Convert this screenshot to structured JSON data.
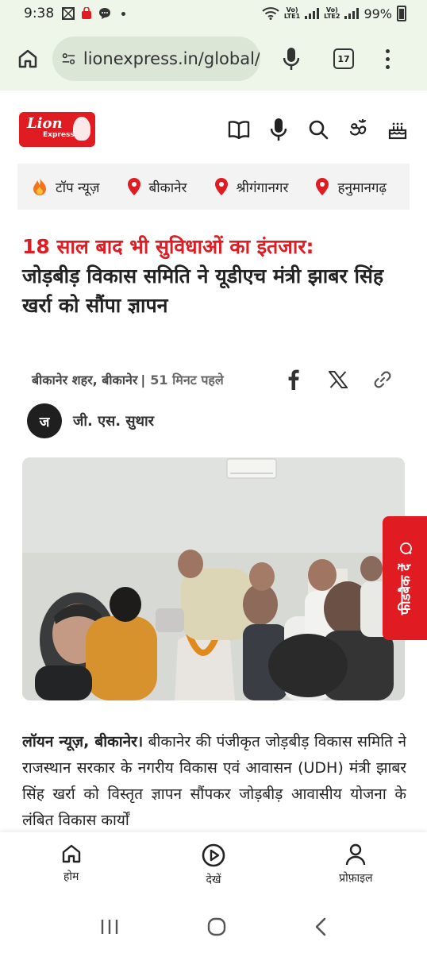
{
  "status_bar": {
    "time": "9:38",
    "battery": "99%",
    "sim1": "LTE1",
    "sim2": "LTE2"
  },
  "browser": {
    "url": "lionexpress.in/global/",
    "tab_count": "17"
  },
  "site": {
    "logo_line1": "Lion",
    "logo_line2": "Express"
  },
  "categories": [
    {
      "label": "टॉप न्यूज़",
      "icon": "fire-icon"
    },
    {
      "label": "बीकानेर",
      "icon": "location-pin-icon"
    },
    {
      "label": "श्रीगंगानगर",
      "icon": "location-pin-icon"
    },
    {
      "label": "हनुमानगढ़",
      "icon": "location-pin-icon"
    }
  ],
  "article": {
    "headline_red": "18 साल बाद भी सुविधाओं का इंतजार:",
    "headline_black": "जोड़बीड़ विकास समिति ने यूडीएच मंत्री झाबर सिंह खर्रा को सौंपा ज्ञापन",
    "location": "बीकानेर शहर, बीकानेर",
    "separator": "|",
    "time_ago": "51 मिनट पहले",
    "author_initial": "ज",
    "author_name": "जी. एस. सुथार",
    "body_lead": "लॉयन न्यूज़, बीकानेर।",
    "body_text": "बीकानेर की पंजीकृत जोड़बीड़ विकास समिति ने राजस्थान सरकार के नगरीय विकास एवं आवासन (UDH) मंत्री झाबर सिंह खर्रा को विस्तृत ज्ञापन सौंपकर जोड़बीड़ आवासीय योजना के लंबित विकास कार्यों"
  },
  "feedback": {
    "label": "फीडबैक दें"
  },
  "bottom_nav": {
    "home": "होम",
    "watch": "देखें",
    "profile": "प्रोफ़ाइल"
  },
  "colors": {
    "brand_red": "#e11b22",
    "browser_bg": "#eef6ea"
  }
}
